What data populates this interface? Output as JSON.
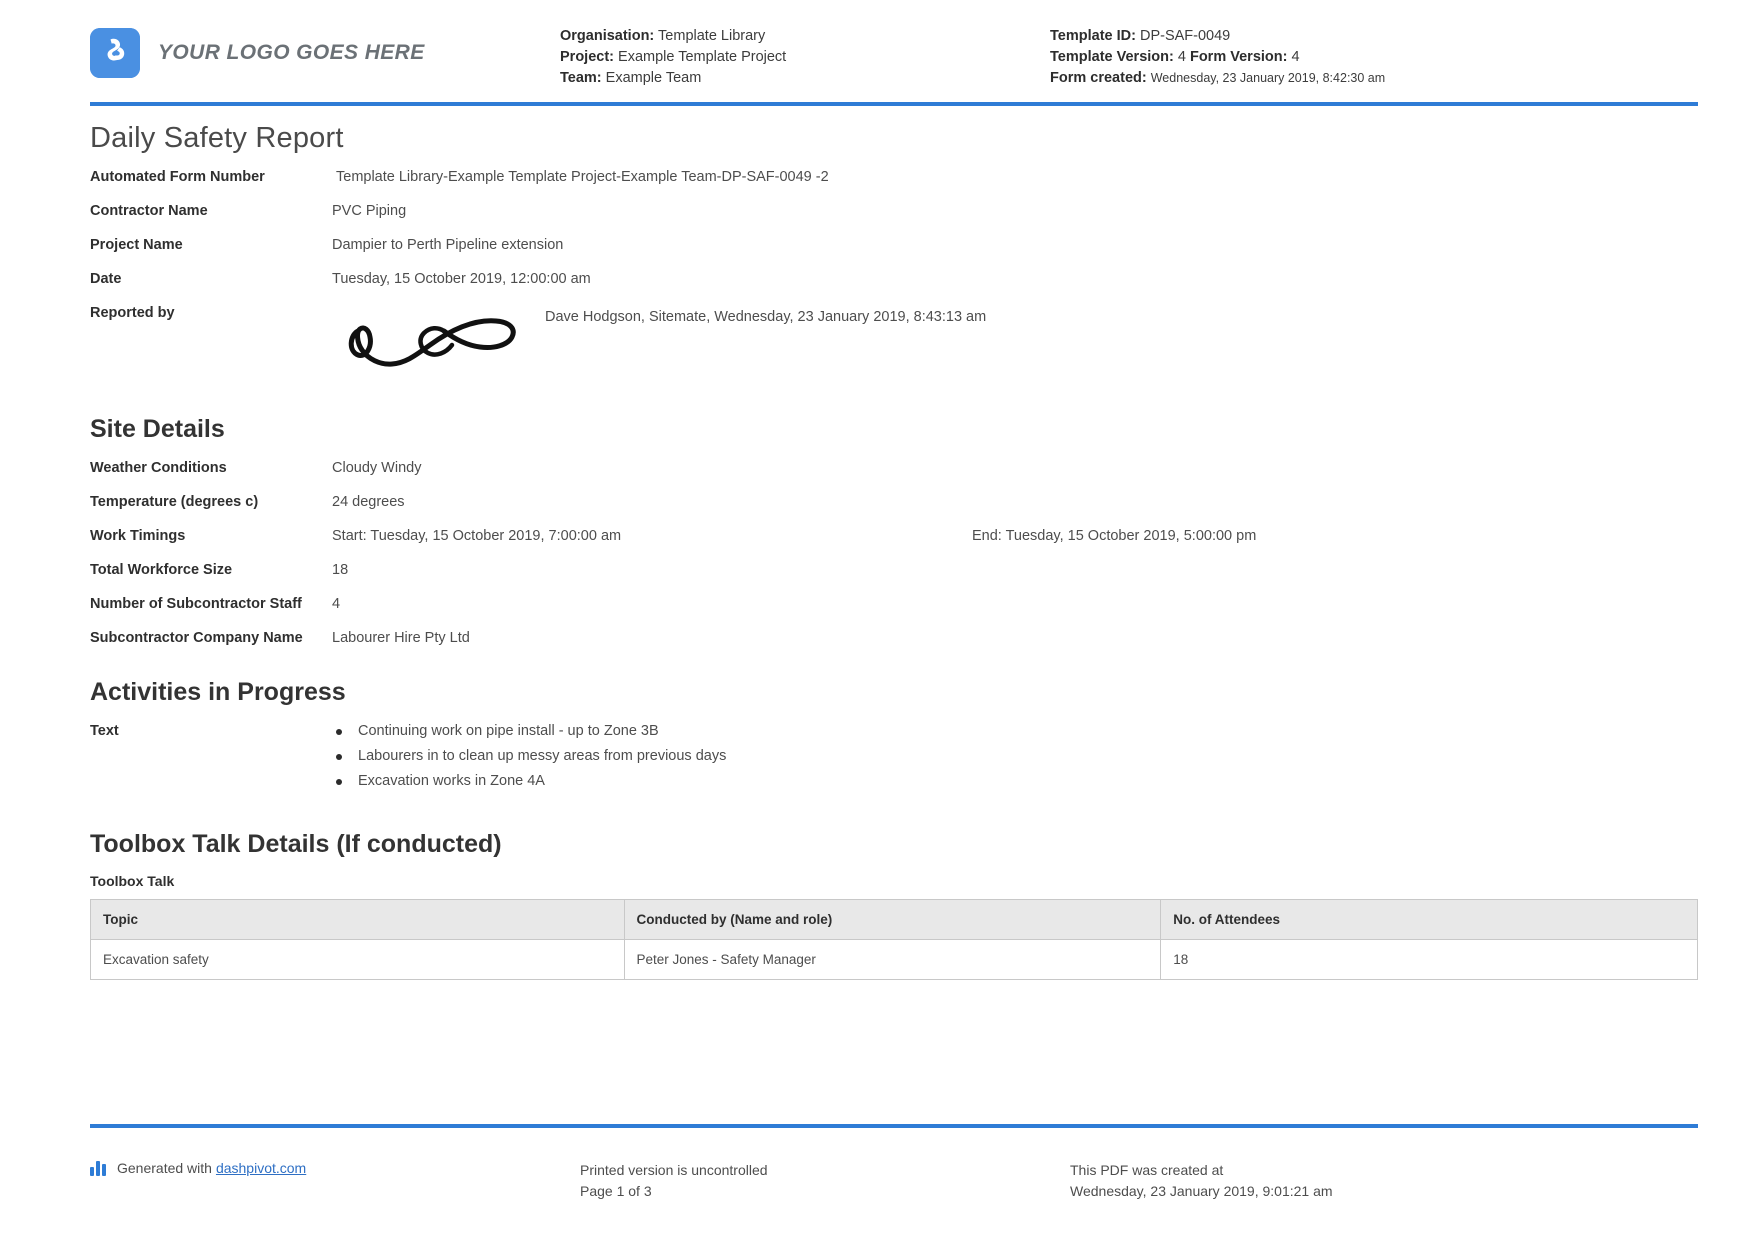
{
  "header": {
    "logo_text": "YOUR LOGO GOES HERE",
    "org_label": "Organisation:",
    "org_value": "Template Library",
    "project_label": "Project:",
    "project_value": "Example Template Project",
    "team_label": "Team:",
    "team_value": "Example Team",
    "template_id_label": "Template ID:",
    "template_id_value": "DP-SAF-0049",
    "template_version_label": "Template Version:",
    "template_version_value": "4",
    "form_version_label": "Form Version:",
    "form_version_value": "4",
    "form_created_label": "Form created:",
    "form_created_value": "Wednesday, 23 January 2019, 8:42:30 am"
  },
  "title": "Daily Safety Report",
  "summary_fields": [
    {
      "label": "Automated Form Number",
      "value": "Template Library-Example Template Project-Example Team-DP-SAF-0049   -2"
    },
    {
      "label": "Contractor Name",
      "value": "PVC Piping"
    },
    {
      "label": "Project Name",
      "value": "Dampier to Perth Pipeline extension"
    },
    {
      "label": "Date",
      "value": "Tuesday, 15 October 2019, 12:00:00 am"
    }
  ],
  "reported_by": {
    "label": "Reported by",
    "signature_alt": "signature",
    "caption": "Dave Hodgson, Sitemate, Wednesday, 23 January 2019, 8:43:13 am"
  },
  "site_details": {
    "heading": "Site Details",
    "fields": [
      {
        "label": "Weather Conditions",
        "value": "Cloudy   Windy"
      },
      {
        "label": "Temperature (degrees c)",
        "value": "24 degrees"
      }
    ],
    "work_timings": {
      "label": "Work Timings",
      "start": "Start: Tuesday, 15 October 2019, 7:00:00 am",
      "end": "End: Tuesday, 15 October 2019, 5:00:00 pm"
    },
    "fields_after": [
      {
        "label": "Total Workforce Size",
        "value": "18"
      },
      {
        "label": "Number of Subcontractor Staff",
        "value": "4"
      },
      {
        "label": "Subcontractor Company Name",
        "value": "Labourer Hire Pty Ltd"
      }
    ]
  },
  "activities": {
    "heading": "Activities in Progress",
    "label": "Text",
    "items": [
      "Continuing work on pipe install - up to Zone 3B",
      "Labourers in to clean up messy areas from previous days",
      "Excavation works in Zone 4A"
    ]
  },
  "toolbox": {
    "heading": "Toolbox Talk Details (If conducted)",
    "caption": "Toolbox Talk",
    "columns": [
      "Topic",
      "Conducted by (Name and role)",
      "No. of Attendees"
    ],
    "rows": [
      [
        "Excavation safety",
        "Peter Jones - Safety Manager",
        "18"
      ]
    ]
  },
  "footer": {
    "generated_prefix": "Generated with",
    "generated_link": "dashpivot.com",
    "printed_line1": "Printed version is uncontrolled",
    "printed_line2": "Page 1 of 3",
    "created_line1": "This PDF was created at",
    "created_line2": "Wednesday, 23 January 2019, 9:01:21 am"
  },
  "colors": {
    "accent_blue": "#2e7cd6",
    "logo_blue": "#4a90e2",
    "table_header_bg": "#e8e8e8"
  }
}
